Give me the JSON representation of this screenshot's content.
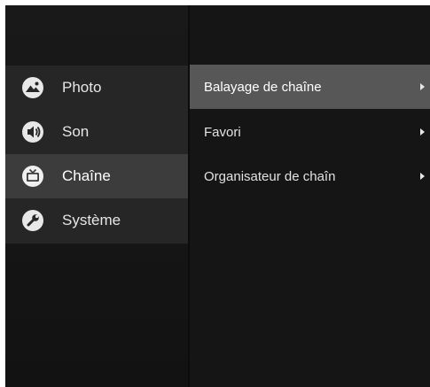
{
  "menu": {
    "categories": [
      {
        "label": "Photo",
        "icon": "photo-icon"
      },
      {
        "label": "Son",
        "icon": "sound-icon"
      },
      {
        "label": "Chaîne",
        "icon": "tv-icon",
        "selected": true
      },
      {
        "label": "Système",
        "icon": "wrench-icon"
      }
    ],
    "submenu": [
      {
        "label": "Balayage de chaîne",
        "icon": "arrow-right-icon",
        "selected": true
      },
      {
        "label": "Favori",
        "icon": "arrow-right-icon"
      },
      {
        "label": "Organisateur de chaîn",
        "icon": "arrow-right-icon"
      }
    ]
  },
  "colors": {
    "background": "#141414",
    "category_selected": "#3c3c3c",
    "submenu_selected": "#575757",
    "text": "#e6e6e6"
  }
}
